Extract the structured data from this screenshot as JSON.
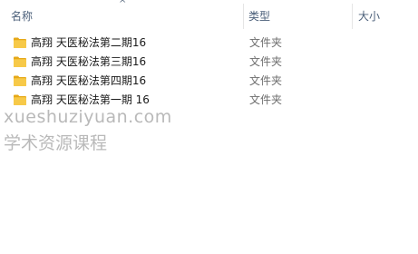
{
  "columns": {
    "name": "名称",
    "type": "类型",
    "size": "大小",
    "sort_indicator": "^"
  },
  "files": [
    {
      "name": "高翔 天医秘法第二期16",
      "type": "文件夹",
      "icon": "folder-icon"
    },
    {
      "name": "高翔 天医秘法第三期16",
      "type": "文件夹",
      "icon": "folder-icon"
    },
    {
      "name": "高翔 天医秘法第四期16",
      "type": "文件夹",
      "icon": "folder-icon"
    },
    {
      "name": "高翔 天医秘法第一期 16",
      "type": "文件夹",
      "icon": "folder-icon"
    }
  ],
  "watermark": {
    "line1": "xueshuziyuan.com",
    "line2": "学术资源课程"
  },
  "colors": {
    "folder": "#f7c948",
    "folder_dark": "#e6a817",
    "header_text": "#4c607a",
    "watermark": "#b9b9b9"
  }
}
